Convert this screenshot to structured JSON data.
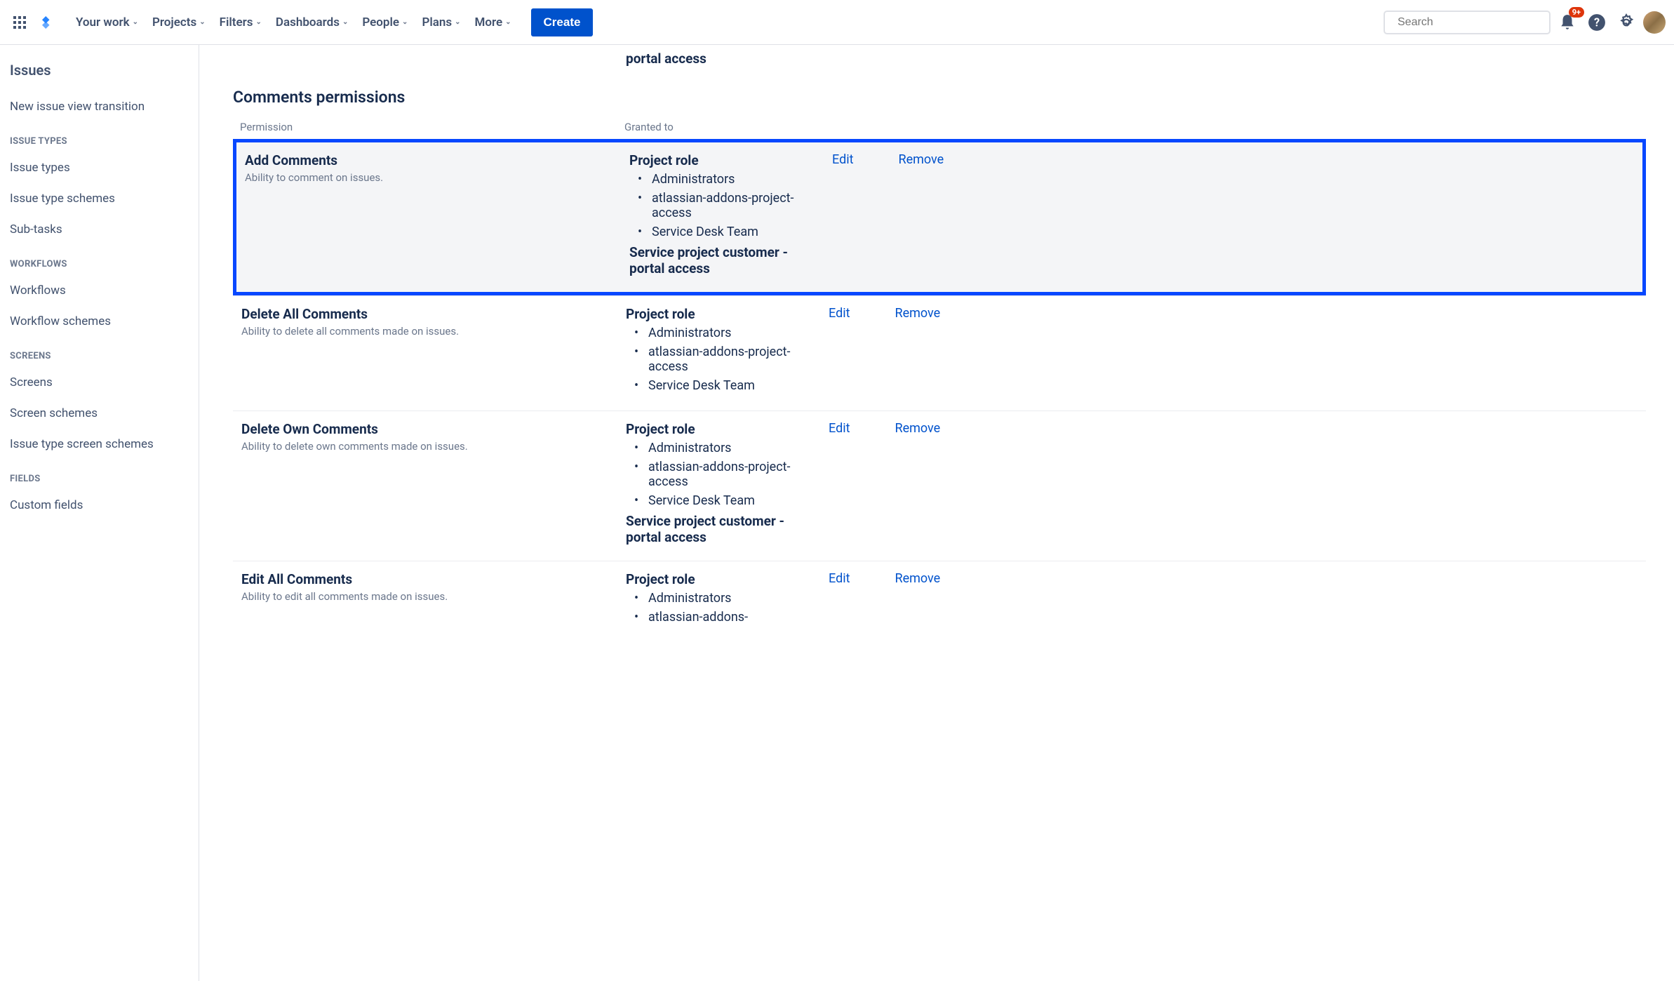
{
  "topbar": {
    "nav": [
      {
        "label": "Your work"
      },
      {
        "label": "Projects"
      },
      {
        "label": "Filters"
      },
      {
        "label": "Dashboards"
      },
      {
        "label": "People"
      },
      {
        "label": "Plans"
      },
      {
        "label": "More"
      }
    ],
    "create": "Create",
    "search_placeholder": "Search",
    "notif_count": "9+"
  },
  "sidebar": {
    "title": "Issues",
    "items": [
      {
        "type": "item",
        "label": "New issue view transition"
      },
      {
        "type": "group",
        "label": "ISSUE TYPES"
      },
      {
        "type": "item",
        "label": "Issue types"
      },
      {
        "type": "item",
        "label": "Issue type schemes"
      },
      {
        "type": "item",
        "label": "Sub-tasks"
      },
      {
        "type": "group",
        "label": "WORKFLOWS"
      },
      {
        "type": "item",
        "label": "Workflows"
      },
      {
        "type": "item",
        "label": "Workflow schemes"
      },
      {
        "type": "group",
        "label": "SCREENS"
      },
      {
        "type": "item",
        "label": "Screens"
      },
      {
        "type": "item",
        "label": "Screen schemes"
      },
      {
        "type": "item",
        "label": "Issue type screen schemes"
      },
      {
        "type": "group",
        "label": "FIELDS"
      },
      {
        "type": "item",
        "label": "Custom fields"
      }
    ]
  },
  "content": {
    "truncated_top": "portal access",
    "section_title": "Comments permissions",
    "col_permission": "Permission",
    "col_granted": "Granted to",
    "edit": "Edit",
    "remove": "Remove",
    "role_label": "Project role",
    "extra_grant": "Service project customer - portal access",
    "permissions": [
      {
        "name": "Add Comments",
        "desc": "Ability to comment on issues.",
        "roles": [
          "Administrators",
          "atlassian-addons-project-access",
          "Service Desk Team"
        ],
        "extra": true,
        "highlighted": true
      },
      {
        "name": "Delete All Comments",
        "desc": "Ability to delete all comments made on issues.",
        "roles": [
          "Administrators",
          "atlassian-addons-project-access",
          "Service Desk Team"
        ],
        "extra": false,
        "highlighted": false
      },
      {
        "name": "Delete Own Comments",
        "desc": "Ability to delete own comments made on issues.",
        "roles": [
          "Administrators",
          "atlassian-addons-project-access",
          "Service Desk Team"
        ],
        "extra": true,
        "highlighted": false
      },
      {
        "name": "Edit All Comments",
        "desc": "Ability to edit all comments made on issues.",
        "roles": [
          "Administrators",
          "atlassian-addons-"
        ],
        "extra": false,
        "highlighted": false
      }
    ]
  }
}
